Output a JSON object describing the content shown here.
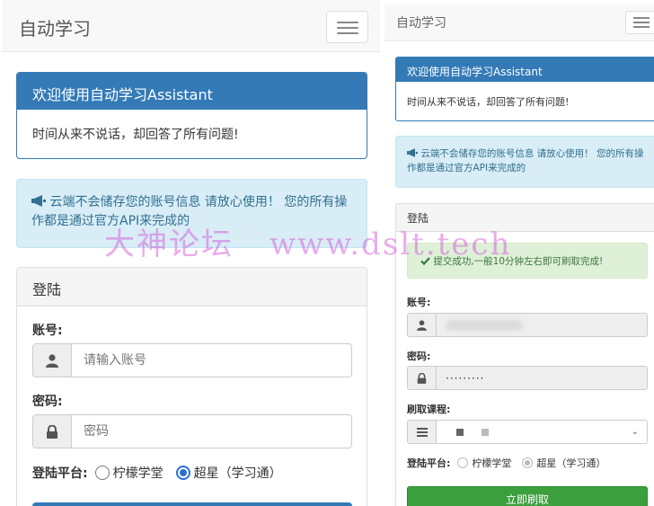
{
  "left": {
    "navbar": {
      "brand": "自动学习"
    },
    "welcome": {
      "title": "欢迎使用自动学习Assistant",
      "body": "时间从来不说话，却回答了所有问题!"
    },
    "notice": {
      "text": "云端不会储存您的账号信息 请放心使用！ 您的所有操作都是通过官方API来完成的"
    },
    "login": {
      "title": "登陆",
      "account_label": "账号:",
      "account_placeholder": "请输入账号",
      "password_label": "密码:",
      "password_placeholder": "密码",
      "platform_label": "登陆平台:",
      "platform_options": [
        "柠檬学堂",
        "超星（学习通）"
      ],
      "platform_selected": "超星（学习通）"
    }
  },
  "right": {
    "navbar": {
      "brand": "自动学习"
    },
    "welcome": {
      "title": "欢迎使用自动学习Assistant",
      "body": "时间从来不说话，却回答了所有问题!"
    },
    "notice": {
      "text": "云端不会储存您的账号信息 请放心使用！ 您的所有操作都是通过官方API来完成的"
    },
    "login": {
      "title": "登陆",
      "success": "提交成功,一般10分钟左右即可刷取完成!",
      "account_label": "账号:",
      "password_label": "密码:",
      "password_value": "·········",
      "course_label": "刷取课程:",
      "platform_label": "登陆平台:",
      "platform_options": [
        "柠檬学堂",
        "超星（学习通）"
      ],
      "submit_label": "立即刷取"
    }
  },
  "watermark": {
    "part1": "大神论坛",
    "part2": "www.dslt.tech"
  },
  "colors": {
    "primary": "#337ab7",
    "info_bg": "#d9edf7",
    "info_text": "#31708f",
    "success_bg": "#dff0d8",
    "success_text": "#3c763d",
    "button_success": "#3c9f3e"
  }
}
